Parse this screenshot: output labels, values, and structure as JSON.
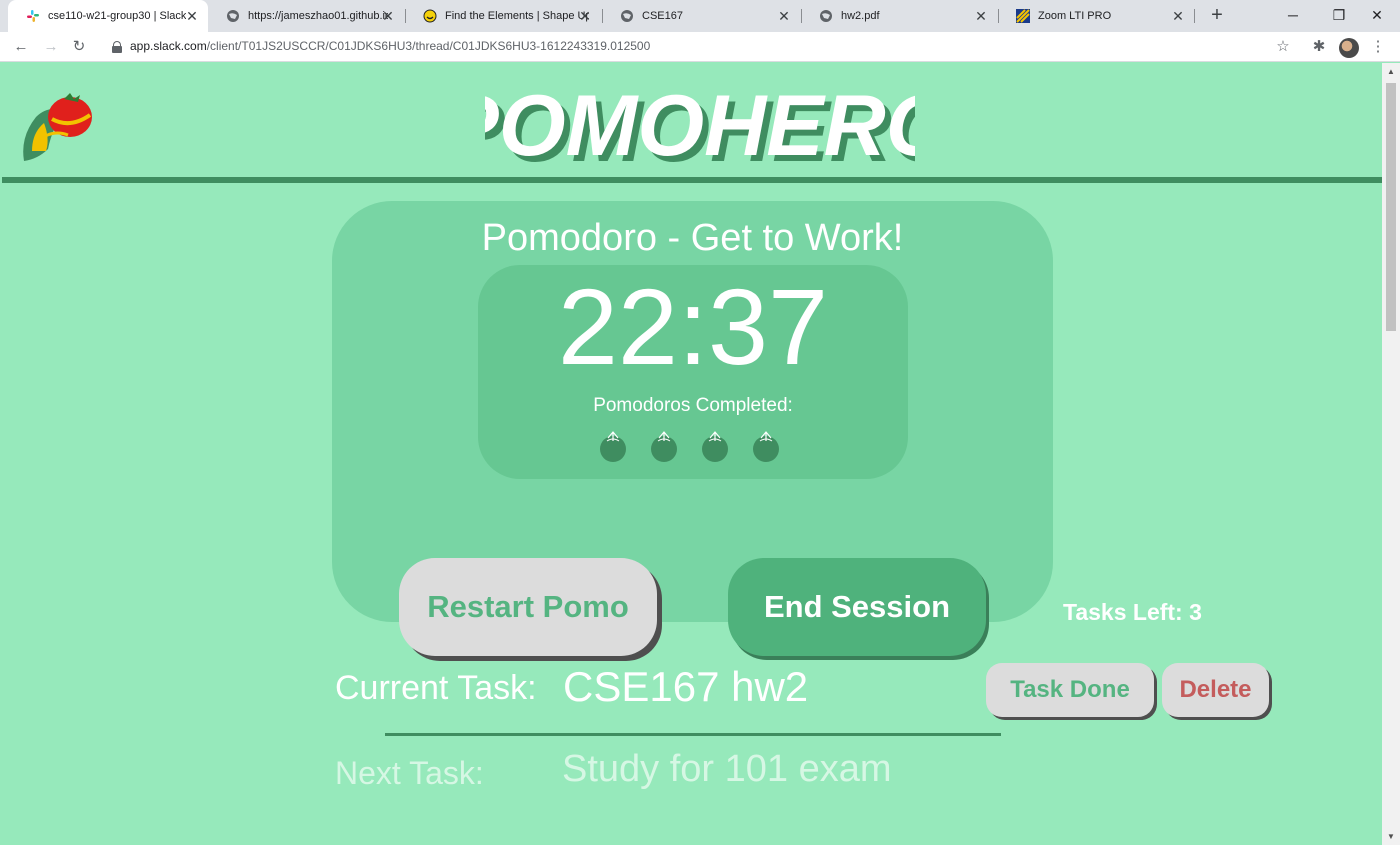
{
  "browser": {
    "tabs": [
      {
        "title": "cse110-w21-group30 | Slack",
        "active": true,
        "icon": "slack-icon"
      },
      {
        "title": "https://jameszhao01.github.io",
        "active": false,
        "icon": "globe-icon"
      },
      {
        "title": "Find the Elements | Shape Up",
        "active": false,
        "icon": "shapeup-icon"
      },
      {
        "title": "CSE167",
        "active": false,
        "icon": "globe-icon"
      },
      {
        "title": "hw2.pdf",
        "active": false,
        "icon": "globe-icon"
      },
      {
        "title": "Zoom LTI PRO",
        "active": false,
        "icon": "zoom-icon"
      }
    ],
    "url_host": "app.slack.com",
    "url_path": "/client/T01JS2USCCR/C01JDKS6HU3/thread/C01JDKS6HU3-1612243319.012500",
    "colors": {
      "tabstrip": "#dee1e6",
      "toolbar": "#ffffff"
    }
  },
  "app": {
    "title": "POMOHERO",
    "mode_label": "Pomodoro - Get to Work!",
    "timer": "22:37",
    "completed_label": "Pomodoros Completed:",
    "completed_count": 4,
    "restart_label": "Restart Pomo",
    "end_label": "End Session",
    "tasks_left_label": "Tasks Left: 3",
    "current_task_label": "Current Task:",
    "current_task_value": "CSE167 hw2",
    "task_done_label": "Task Done",
    "delete_label": "Delete",
    "next_task_label": "Next Task:",
    "next_task_value": "Study for 101 exam",
    "colors": {
      "background": "#96e9bb",
      "panel": "#78d5a4",
      "timer_box": "#66c792",
      "accent_dark": "#3f8d60",
      "button_green": "#4fb27c",
      "button_gray": "#dcdcdc",
      "delete_red": "#c45c5c"
    }
  }
}
